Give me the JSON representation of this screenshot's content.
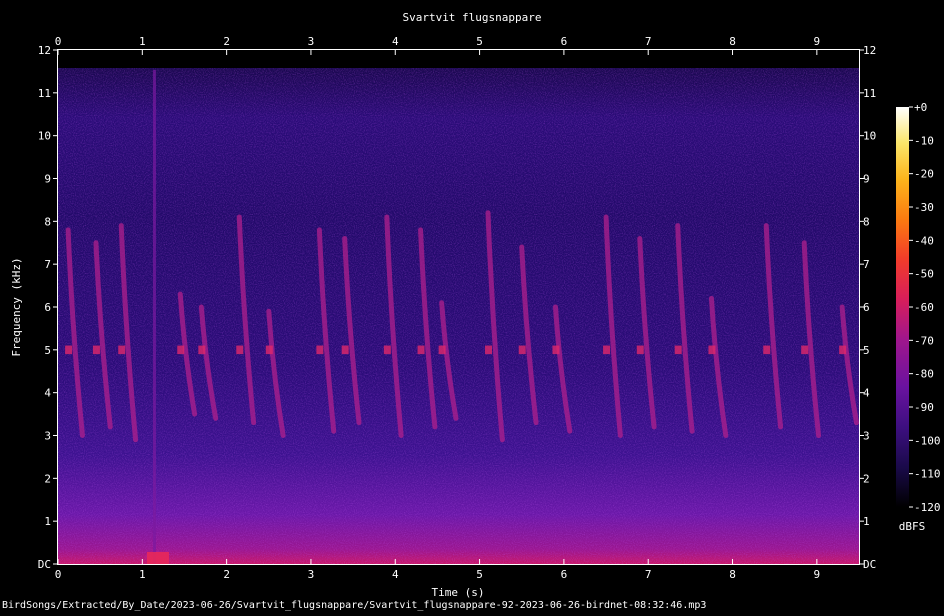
{
  "chart_data": {
    "type": "heatmap",
    "title": "Svartvit flugsnappare",
    "xlabel": "Time (s)",
    "ylabel": "Frequency (kHz)",
    "xlim": [
      0,
      9.5
    ],
    "ylim": [
      0,
      12
    ],
    "x_ticks": [
      "0",
      "1",
      "2",
      "3",
      "4",
      "5",
      "6",
      "7",
      "8",
      "9"
    ],
    "y_ticks": [
      "DC",
      "1",
      "2",
      "3",
      "4",
      "5",
      "6",
      "7",
      "8",
      "9",
      "10",
      "11",
      "12"
    ],
    "colorbar": {
      "label": "dBFS",
      "range": [
        -120,
        0
      ],
      "ticks": [
        "+0",
        "-10",
        "-20",
        "-30",
        "-40",
        "-50",
        "-60",
        "-70",
        "-80",
        "-90",
        "-100",
        "-110",
        "-120"
      ],
      "colors": [
        "#000000",
        "#1a0a4a",
        "#3d0f80",
        "#6a12a0",
        "#a0168c",
        "#d81e5a",
        "#f23c2a",
        "#fb7b10",
        "#fcb51c",
        "#fbe66a",
        "#ffffff"
      ]
    },
    "bird_calls": [
      {
        "t": 0.12,
        "f_high": 7.8,
        "f_low": 3.0
      },
      {
        "t": 0.45,
        "f_high": 7.5,
        "f_low": 3.2
      },
      {
        "t": 0.75,
        "f_high": 7.9,
        "f_low": 2.9
      },
      {
        "t": 1.45,
        "f_high": 6.3,
        "f_low": 3.5
      },
      {
        "t": 1.7,
        "f_high": 6.0,
        "f_low": 3.4
      },
      {
        "t": 2.15,
        "f_high": 8.1,
        "f_low": 3.3
      },
      {
        "t": 2.5,
        "f_high": 5.9,
        "f_low": 3.0
      },
      {
        "t": 3.1,
        "f_high": 7.8,
        "f_low": 3.1
      },
      {
        "t": 3.4,
        "f_high": 7.6,
        "f_low": 3.3
      },
      {
        "t": 3.9,
        "f_high": 8.1,
        "f_low": 3.0
      },
      {
        "t": 4.3,
        "f_high": 7.8,
        "f_low": 3.2
      },
      {
        "t": 4.55,
        "f_high": 6.1,
        "f_low": 3.4
      },
      {
        "t": 5.1,
        "f_high": 8.2,
        "f_low": 2.9
      },
      {
        "t": 5.5,
        "f_high": 7.4,
        "f_low": 3.3
      },
      {
        "t": 5.9,
        "f_high": 6.0,
        "f_low": 3.1
      },
      {
        "t": 6.5,
        "f_high": 8.1,
        "f_low": 3.0
      },
      {
        "t": 6.9,
        "f_high": 7.6,
        "f_low": 3.2
      },
      {
        "t": 7.35,
        "f_high": 7.9,
        "f_low": 3.1
      },
      {
        "t": 7.75,
        "f_high": 6.2,
        "f_low": 3.0
      },
      {
        "t": 8.4,
        "f_high": 7.9,
        "f_low": 3.2
      },
      {
        "t": 8.85,
        "f_high": 7.5,
        "f_low": 3.0
      },
      {
        "t": 9.3,
        "f_high": 6.0,
        "f_low": 3.3
      }
    ],
    "transients": [
      {
        "t": 1.15,
        "level": -50
      }
    ],
    "grid": false
  },
  "footer": {
    "filename": "BirdSongs/Extracted/By_Date/2023-06-26/Svartvit_flugsnappare/Svartvit_flugsnappare-92-2023-06-26-birdnet-08:32:46.mp3"
  }
}
